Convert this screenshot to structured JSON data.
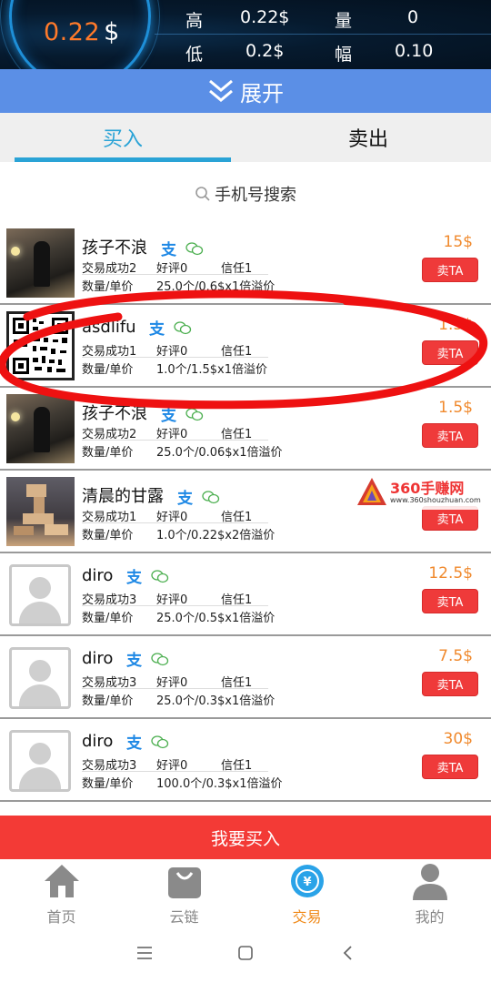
{
  "header": {
    "price_value": "0.22",
    "price_symbol": "$",
    "high_label": "高",
    "high_value": "0.22$",
    "low_label": "低",
    "low_value": "0.2$",
    "volume_label": "量",
    "volume_value": "0",
    "change_label": "幅",
    "change_value": "0.10"
  },
  "expand": {
    "label": "展开"
  },
  "tabs": [
    {
      "label": "买入",
      "active": true
    },
    {
      "label": "卖出",
      "active": false
    }
  ],
  "search": {
    "placeholder": "手机号搜索"
  },
  "list": [
    {
      "name": "孩子不浪",
      "deals": "交易成功2",
      "good": "好评0",
      "trust": "信任1",
      "qty_label": "数量/单价",
      "qty": "25.0个/0.6$x1倍溢价",
      "price": "15$",
      "btn": "卖TA"
    },
    {
      "name": "asdlifu",
      "deals": "交易成功1",
      "good": "好评0",
      "trust": "信任1",
      "qty_label": "数量/单价",
      "qty": "1.0个/1.5$x1倍溢价",
      "price": "1.5$",
      "btn": "卖TA"
    },
    {
      "name": "孩子不浪",
      "deals": "交易成功2",
      "good": "好评0",
      "trust": "信任1",
      "qty_label": "数量/单价",
      "qty": "25.0个/0.06$x1倍溢价",
      "price": "1.5$",
      "btn": "卖TA"
    },
    {
      "name": "清晨的甘露",
      "deals": "交易成功1",
      "good": "好评0",
      "trust": "信任1",
      "qty_label": "数量/单价",
      "qty": "1.0个/0.22$x2倍溢价",
      "price": "",
      "btn": "卖TA"
    },
    {
      "name": "diro",
      "deals": "交易成功3",
      "good": "好评0",
      "trust": "信任1",
      "qty_label": "数量/单价",
      "qty": "25.0个/0.5$x1倍溢价",
      "price": "12.5$",
      "btn": "卖TA"
    },
    {
      "name": "diro",
      "deals": "交易成功3",
      "good": "好评0",
      "trust": "信任1",
      "qty_label": "数量/单价",
      "qty": "25.0个/0.3$x1倍溢价",
      "price": "7.5$",
      "btn": "卖TA"
    },
    {
      "name": "diro",
      "deals": "交易成功3",
      "good": "好评0",
      "trust": "信任1",
      "qty_label": "数量/单价",
      "qty": "100.0个/0.3$x1倍溢价",
      "price": "30$",
      "btn": "卖TA"
    }
  ],
  "watermark": {
    "text": "360手赚网",
    "url": "www.360shouzhuan.com"
  },
  "buy_button": {
    "label": "我要买入"
  },
  "bottom_nav": [
    {
      "label": "首页",
      "icon": "home-icon"
    },
    {
      "label": "云链",
      "icon": "bag-icon"
    },
    {
      "label": "交易",
      "icon": "yuan-coin-icon",
      "active": true
    },
    {
      "label": "我的",
      "icon": "person-icon"
    }
  ],
  "colors": {
    "accent_blue": "#5b8fe6",
    "tab_active": "#2aa3d6",
    "price_orange": "#f08a2e",
    "button_red": "#ef3a3a",
    "buy_bar_red": "#f33a36",
    "nav_active": "#f08a1a"
  }
}
